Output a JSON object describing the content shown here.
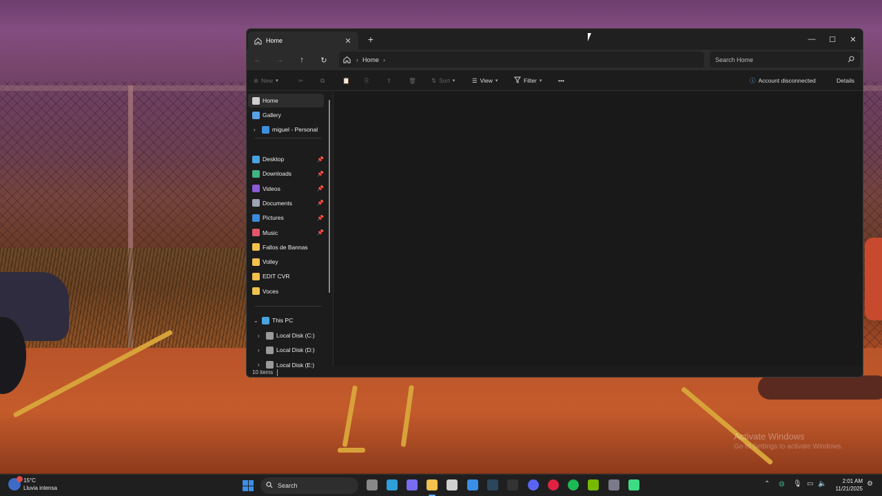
{
  "window": {
    "tab_title": "Home",
    "tab_close_glyph": "✕",
    "new_tab_glyph": "+",
    "controls": {
      "minimize": "—",
      "maximize": "☐",
      "close": "✕"
    }
  },
  "nav": {
    "back_glyph": "←",
    "forward_glyph": "→",
    "up_glyph": "↑",
    "refresh_glyph": "↻",
    "breadcrumb": [
      "Home"
    ],
    "search_placeholder": "Search Home"
  },
  "toolbar": {
    "new_label": "New",
    "sort_label": "Sort",
    "view_label": "View",
    "filter_label": "Filter",
    "more_glyph": "•••",
    "account_status": "Account disconnected",
    "details_label": "Details"
  },
  "sidebar": {
    "top": [
      {
        "label": "Home",
        "icon": "home-icon",
        "color": "#cfcfcf"
      },
      {
        "label": "Gallery",
        "icon": "gallery-icon",
        "color": "#5aa0e6"
      },
      {
        "label": "miguel - Personal",
        "icon": "onedrive-icon",
        "color": "#3d8fe0"
      }
    ],
    "quick_access": [
      {
        "label": "Desktop",
        "icon": "desktop-icon",
        "color": "#4aa3df",
        "pinned": true
      },
      {
        "label": "Downloads",
        "icon": "downloads-icon",
        "color": "#3fb27f",
        "pinned": true
      },
      {
        "label": "Videos",
        "icon": "videos-icon",
        "color": "#8c5bd6",
        "pinned": true
      },
      {
        "label": "Documents",
        "icon": "documents-icon",
        "color": "#9ca3b5",
        "pinned": true
      },
      {
        "label": "Pictures",
        "icon": "pictures-icon",
        "color": "#3b8ad9",
        "pinned": true
      },
      {
        "label": "Music",
        "icon": "music-icon",
        "color": "#e0566b",
        "pinned": true
      },
      {
        "label": "Fallos de Bannas",
        "icon": "folder-icon",
        "color": "#f2c14e",
        "pinned": false
      },
      {
        "label": "Volley",
        "icon": "folder-icon",
        "color": "#f2c14e",
        "pinned": false
      },
      {
        "label": "EDIT CVR",
        "icon": "folder-icon",
        "color": "#f2c14e",
        "pinned": false
      },
      {
        "label": "Voces",
        "icon": "folder-icon",
        "color": "#f2c14e",
        "pinned": false
      }
    ],
    "this_pc": {
      "label": "This PC",
      "icon": "pc-icon",
      "color": "#4aa3df"
    },
    "drives": [
      {
        "label": "Local Disk (C:)"
      },
      {
        "label": "Local Disk (D:)"
      },
      {
        "label": "Local Disk (E:)"
      }
    ],
    "pin_glyph": "📌",
    "expand_glyph": "›",
    "collapse_glyph": "⌄"
  },
  "status": {
    "items_count": "10 items"
  },
  "taskbar": {
    "weather_temp": "15°C",
    "weather_desc": "Lluvia intensa",
    "search_label": "Search",
    "time": "2:01 AM",
    "date": "11/21/2025",
    "apps": [
      {
        "name": "task-view-icon",
        "color": "#888888"
      },
      {
        "name": "edge-icon",
        "color": "#2f9fd8"
      },
      {
        "name": "copilot-icon",
        "color": "#7a6cf0"
      },
      {
        "name": "file-explorer-icon",
        "color": "#f2c14e"
      },
      {
        "name": "roblox-studio-icon",
        "color": "#d0d0d0"
      },
      {
        "name": "microsoft-store-icon",
        "color": "#3a8ee6"
      },
      {
        "name": "steam-icon",
        "color": "#2a475e"
      },
      {
        "name": "epic-games-icon",
        "color": "#333333"
      },
      {
        "name": "discord-icon",
        "color": "#5865f2"
      },
      {
        "name": "opera-gx-icon",
        "color": "#e0223f"
      },
      {
        "name": "spotify-icon",
        "color": "#1db954"
      },
      {
        "name": "nvidia-icon",
        "color": "#76b900"
      },
      {
        "name": "camera-icon",
        "color": "#7a7a8a"
      },
      {
        "name": "android-studio-icon",
        "color": "#3ddc84"
      }
    ]
  },
  "desktop": {
    "watermark_title": "Activate Windows",
    "watermark_sub": "Go to Settings to activate Windows."
  }
}
